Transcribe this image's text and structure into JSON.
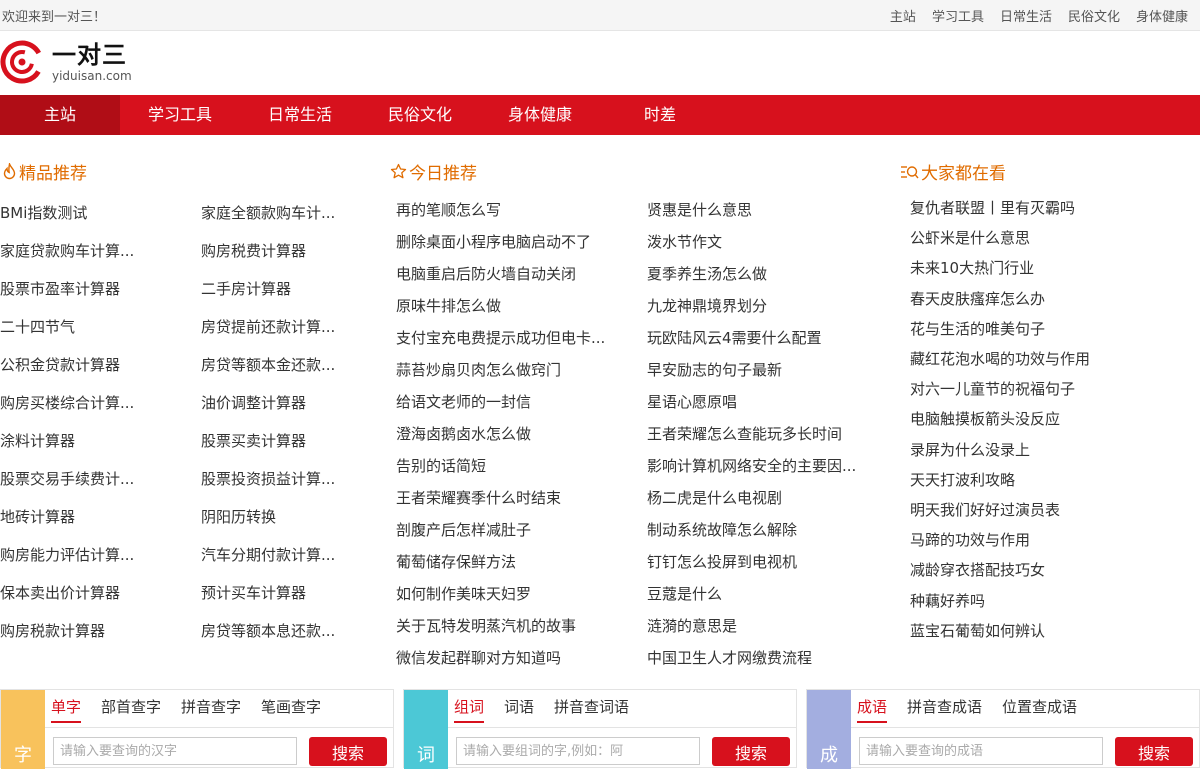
{
  "topbar": {
    "welcome": "欢迎来到一对三！",
    "links": [
      "主站",
      "学习工具",
      "日常生活",
      "民俗文化",
      "身体健康"
    ]
  },
  "logo": {
    "name": "一对三",
    "domain": "yiduisan.com"
  },
  "nav": {
    "items": [
      "主站",
      "学习工具",
      "日常生活",
      "民俗文化",
      "身体健康",
      "时差"
    ],
    "active": "主站"
  },
  "featured": {
    "title": "精品推荐",
    "icon": "flame-icon",
    "left": [
      "BMi指数测试",
      "家庭贷款购车计算...",
      "股票市盈率计算器",
      "二十四节气",
      "公积金贷款计算器",
      "购房买楼综合计算...",
      "涂料计算器",
      "股票交易手续费计...",
      "地砖计算器",
      "购房能力评估计算...",
      "保本卖出价计算器",
      "购房税款计算器"
    ],
    "right": [
      "家庭全额款购车计...",
      "购房税费计算器",
      "二手房计算器",
      "房贷提前还款计算...",
      "房贷等额本金还款...",
      "油价调整计算器",
      "股票买卖计算器",
      "股票投资损益计算...",
      "阴阳历转换",
      "汽车分期付款计算...",
      "预计买车计算器",
      "房贷等额本息还款..."
    ]
  },
  "today": {
    "title": "今日推荐",
    "icon": "star-icon",
    "left": [
      "再的笔顺怎么写",
      "删除桌面小程序电脑启动不了",
      "电脑重启后防火墙自动关闭",
      "原味牛排怎么做",
      "支付宝充电费提示成功但电卡...",
      "蒜苔炒扇贝肉怎么做窍门",
      "给语文老师的一封信",
      "澄海卤鹅卤水怎么做",
      "告别的话简短",
      "王者荣耀赛季什么时结束",
      "剖腹产后怎样减肚子",
      "葡萄储存保鲜方法",
      "如何制作美味天妇罗",
      "关于瓦特发明蒸汽机的故事",
      "微信发起群聊对方知道吗"
    ],
    "right": [
      "贤惠是什么意思",
      "泼水节作文",
      "夏季养生汤怎么做",
      "九龙神鼎境界划分",
      "玩欧陆风云4需要什么配置",
      "早安励志的句子最新",
      "星语心愿原唱",
      "王者荣耀怎么查能玩多长时间",
      "影响计算机网络安全的主要因...",
      "杨二虎是什么电视剧",
      "制动系统故障怎么解除",
      "钉钉怎么投屏到电视机",
      "豆蔻是什么",
      "涟漪的意思是",
      "中国卫生人才网缴费流程"
    ]
  },
  "popular": {
    "title": "大家都在看",
    "icon": "search-list-icon",
    "items": [
      "复仇者联盟丨里有灭霸吗",
      "公虾米是什么意思",
      "未来10大热门行业",
      "春天皮肤瘙痒怎么办",
      "花与生活的唯美句子",
      "藏红花泡水喝的功效与作用",
      "对六一儿童节的祝福句子",
      "电脑触摸板箭头没反应",
      "录屏为什么没录上",
      "天天打波利攻略",
      "明天我们好好过演员表",
      "马蹄的功效与作用",
      "减龄穿衣搭配技巧女",
      "种藕好养吗",
      "蓝宝石葡萄如何辨认"
    ]
  },
  "search_boxes": [
    {
      "badge": "字",
      "color": "#f8c25c",
      "tabs": [
        "单字",
        "部首查字",
        "拼音查字",
        "笔画查字"
      ],
      "active": "单字",
      "placeholder": "请输入要查询的汉字",
      "button": "搜索"
    },
    {
      "badge": "词",
      "color": "#4cc8d6",
      "tabs": [
        "组词",
        "词语",
        "拼音查词语"
      ],
      "active": "组词",
      "placeholder": "请输入要组词的字,例如：阿",
      "button": "搜索"
    },
    {
      "badge": "成",
      "color": "#a3aee0",
      "tabs": [
        "成语",
        "拼音查成语",
        "位置查成语"
      ],
      "active": "成语",
      "placeholder": "请输入要查询的成语",
      "button": "搜索"
    }
  ],
  "colors": {
    "brand_red": "#d7111d",
    "nav_active": "#b00d16",
    "section_title": "#e06c00"
  }
}
